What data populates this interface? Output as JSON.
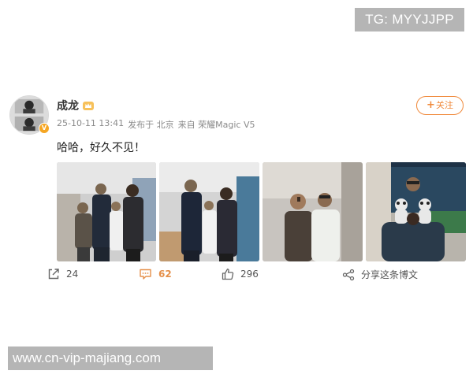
{
  "watermarks": {
    "top": "TG: MYYJJPP",
    "bottom": "www.cn-vip-majiang.com"
  },
  "post": {
    "author": {
      "name": "成龙",
      "avatar_icon": "avatar-photo",
      "verified_badge_icon": "verified-v-icon",
      "member_icon": "crown-icon"
    },
    "meta": {
      "datetime": "25-10-11 13:41",
      "location": "发布于 北京",
      "source": "来自 荣耀Magic V5"
    },
    "follow_label": "关注",
    "follow_plus": "+",
    "text": "哈哈，好久不见！",
    "photos": [
      {
        "name": "photo-1"
      },
      {
        "name": "photo-2"
      },
      {
        "name": "photo-3"
      },
      {
        "name": "photo-4"
      }
    ],
    "actions": {
      "repost_count": "24",
      "comment_count": "62",
      "like_count": "296",
      "share_label": "分享这条博文"
    }
  },
  "colors": {
    "accent": "#f08a3c",
    "comment_highlight": "#e5904a",
    "meta_text": "#8a8a8a"
  }
}
